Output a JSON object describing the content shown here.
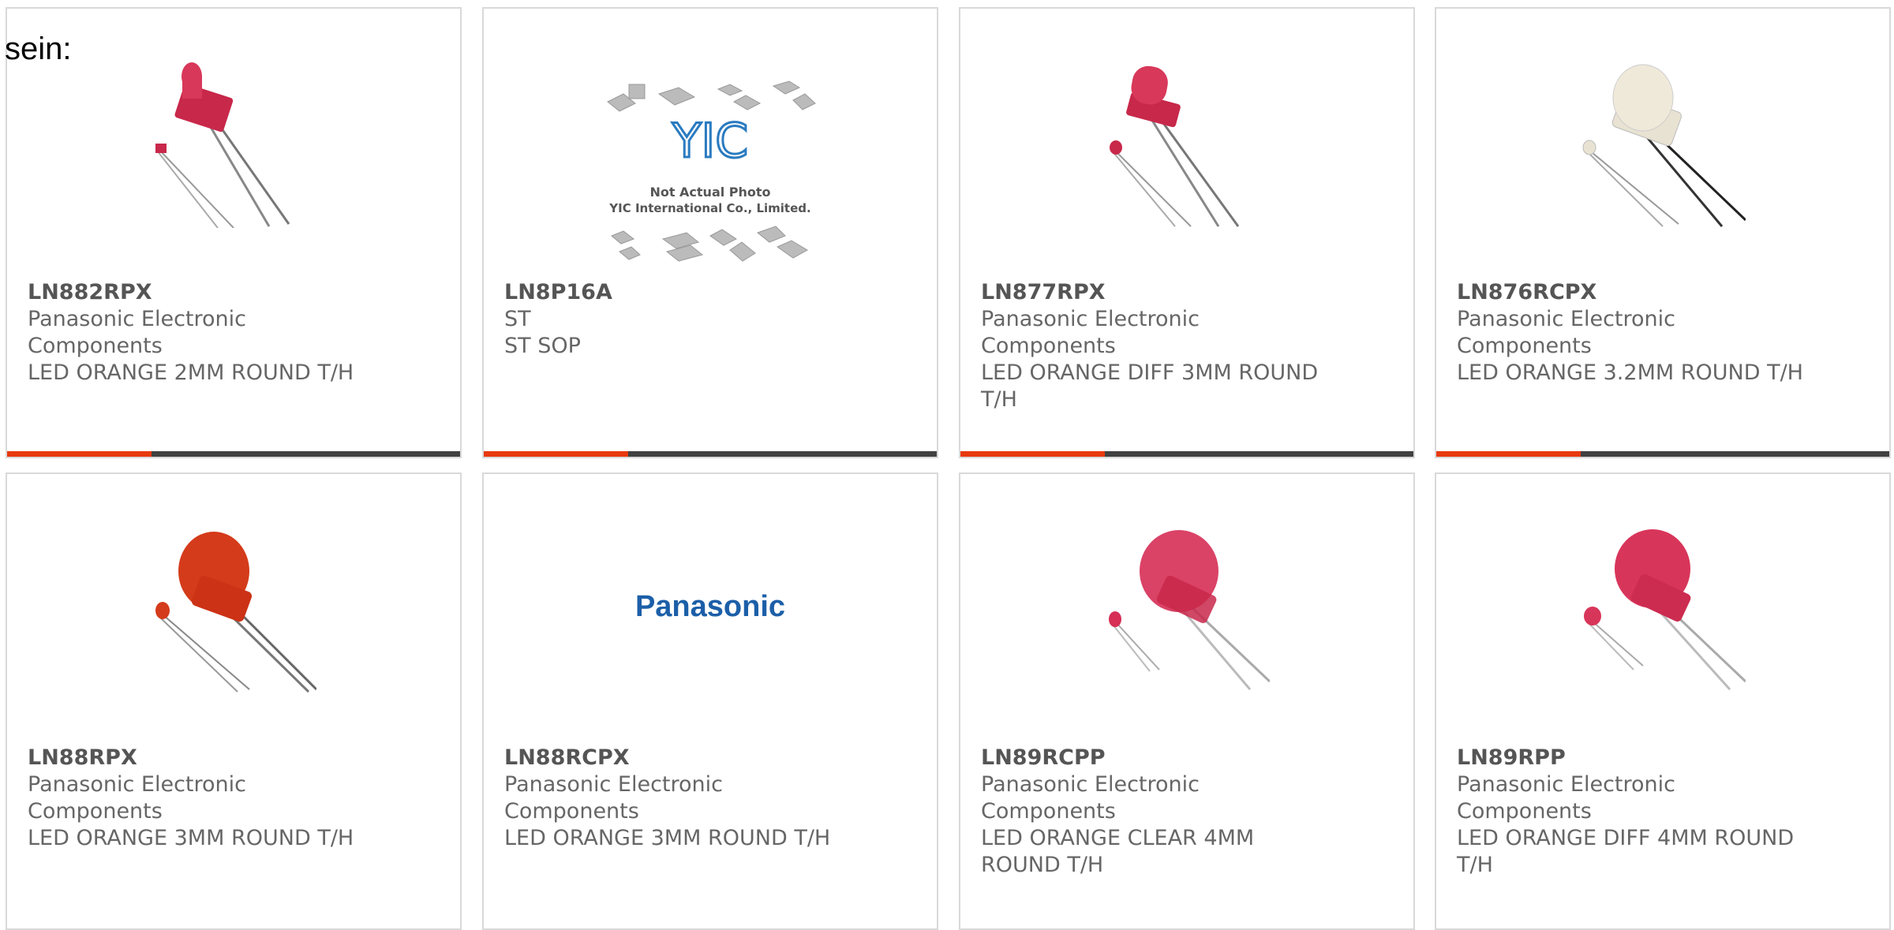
{
  "intro_text": "sein:",
  "accent_color": "#e8390e",
  "bar_color": "#414141",
  "products": [
    {
      "part": "LN882RPX",
      "manufacturer": "Panasonic Electronic Components",
      "description": "LED ORANGE 2MM ROUND T/H",
      "image": "led-2mm-icon"
    },
    {
      "part": "LN8P16A",
      "manufacturer": "ST",
      "description": "ST SOP",
      "image": "not-actual-photo-icon",
      "placeholder": {
        "logo": "YIC",
        "line1": "Not Actual Photo",
        "line2": "YIC International Co., Limited."
      }
    },
    {
      "part": "LN877RPX",
      "manufacturer": "Panasonic Electronic Components",
      "description": "LED ORANGE DIFF 3MM ROUND T/H",
      "image": "led-3mm-diff-icon"
    },
    {
      "part": "LN876RCPX",
      "manufacturer": "Panasonic Electronic Components",
      "description": "LED ORANGE 3.2MM ROUND T/H",
      "image": "led-3-2mm-clear-icon"
    },
    {
      "part": "LN88RPX",
      "manufacturer": "Panasonic Electronic Components",
      "description": "LED ORANGE 3MM ROUND T/H",
      "image": "led-3mm-orange-icon"
    },
    {
      "part": "LN88RCPX",
      "manufacturer": "Panasonic Electronic Components",
      "description": "LED ORANGE 3MM ROUND T/H",
      "image": "panasonic-logo-icon",
      "logo_text": "Panasonic"
    },
    {
      "part": "LN89RCPP",
      "manufacturer": "Panasonic Electronic Components",
      "description": "LED ORANGE CLEAR 4MM ROUND T/H",
      "image": "led-4mm-clear-icon"
    },
    {
      "part": "LN89RPP",
      "manufacturer": "Panasonic Electronic Components",
      "description": "LED ORANGE DIFF 4MM ROUND T/H",
      "image": "led-4mm-diff-icon"
    }
  ]
}
